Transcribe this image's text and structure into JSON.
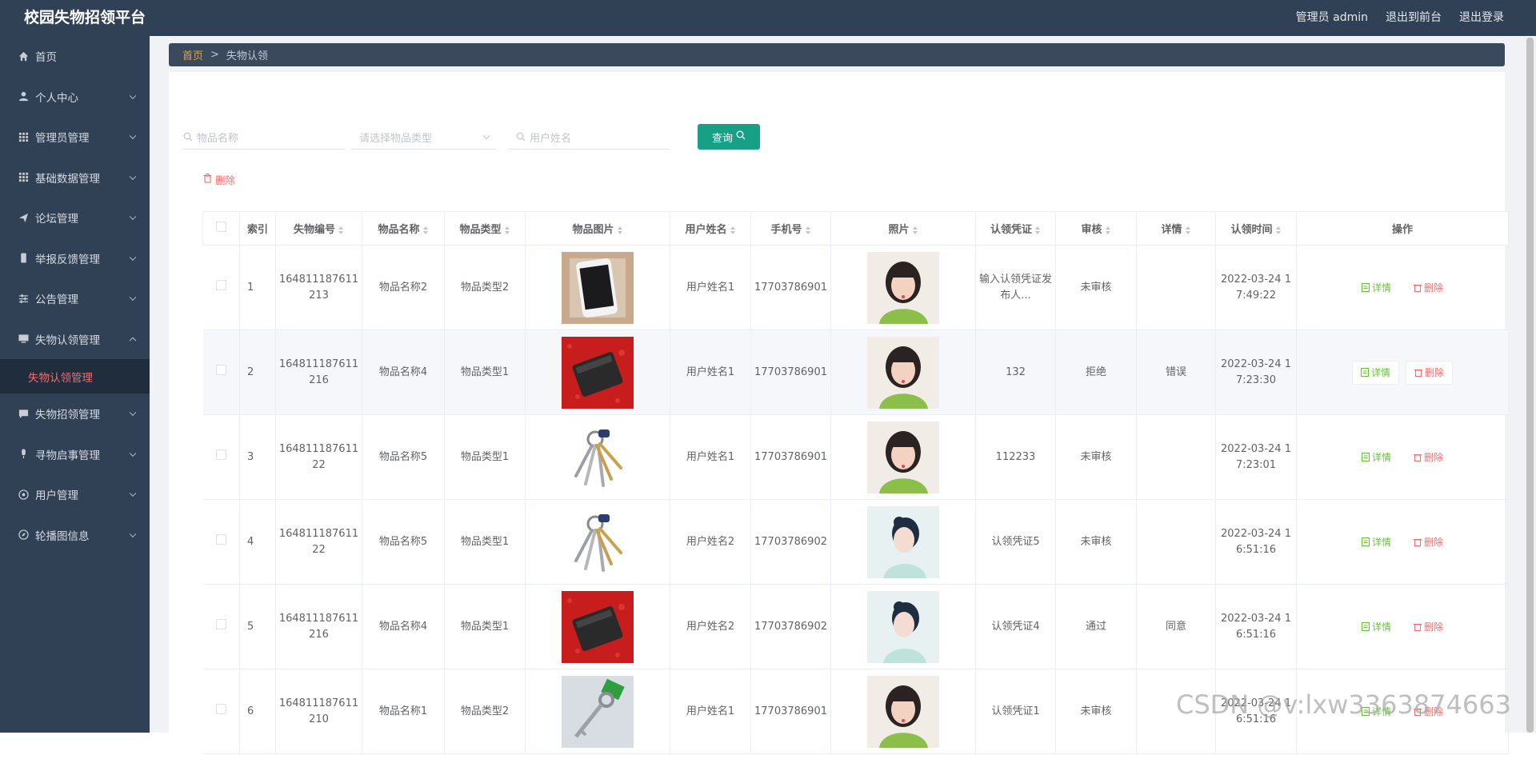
{
  "header": {
    "title": "校园失物招领平台",
    "admin_label": "管理员 admin",
    "exit_front": "退出到前台",
    "logout": "退出登录"
  },
  "sidebar": {
    "items": [
      {
        "label": "首页",
        "icon": "home-icon"
      },
      {
        "label": "个人中心",
        "icon": "user-icon"
      },
      {
        "label": "管理员管理",
        "icon": "grid-icon"
      },
      {
        "label": "基础数据管理",
        "icon": "grid-icon"
      },
      {
        "label": "论坛管理",
        "icon": "send-icon"
      },
      {
        "label": "举报反馈管理",
        "icon": "phone-icon"
      },
      {
        "label": "公告管理",
        "icon": "sliders-icon"
      },
      {
        "label": "失物认领管理",
        "icon": "monitor-icon"
      },
      {
        "label": "失物招领管理",
        "icon": "chat-icon"
      },
      {
        "label": "寻物启事管理",
        "icon": "mic-icon"
      },
      {
        "label": "用户管理",
        "icon": "globe-icon"
      },
      {
        "label": "轮播图信息",
        "icon": "compass-icon"
      }
    ],
    "active_sub": "失物认领管理"
  },
  "breadcrumb": {
    "home": "首页",
    "separator": ">",
    "current": "失物认领"
  },
  "filters": {
    "item_name_placeholder": "物品名称",
    "item_type_placeholder": "请选择物品类型",
    "user_name_placeholder": "用户姓名",
    "query_label": "查询"
  },
  "actions": {
    "delete_label": "删除"
  },
  "table": {
    "columns": [
      "索引",
      "失物编号",
      "物品名称",
      "物品类型",
      "物品图片",
      "用户姓名",
      "手机号",
      "照片",
      "认领凭证",
      "审核",
      "详情",
      "认领时间",
      "操作"
    ],
    "view_label": "详情",
    "del_label": "删除",
    "rows": [
      {
        "index": "1",
        "code": "164811187611213",
        "name": "物品名称2",
        "type": "物品类型2",
        "img": "phone",
        "user": "用户姓名1",
        "phone": "17703786901",
        "photo": "girl1",
        "proof": "输入认领凭证发布人...",
        "review": "未审核",
        "detail": "",
        "time": "2022-03-24 17:49:22"
      },
      {
        "index": "2",
        "code": "164811187611216",
        "name": "物品名称4",
        "type": "物品类型1",
        "img": "wallet",
        "user": "用户姓名1",
        "phone": "17703786901",
        "photo": "girl1",
        "proof": "132",
        "review": "拒绝",
        "detail": "错误",
        "time": "2022-03-24 17:23:30"
      },
      {
        "index": "3",
        "code": "16481118761122",
        "name": "物品名称5",
        "type": "物品类型1",
        "img": "keys",
        "user": "用户姓名1",
        "phone": "17703786901",
        "photo": "girl1",
        "proof": "112233",
        "review": "未审核",
        "detail": "",
        "time": "2022-03-24 17:23:01"
      },
      {
        "index": "4",
        "code": "16481118761122",
        "name": "物品名称5",
        "type": "物品类型1",
        "img": "keys",
        "user": "用户姓名2",
        "phone": "17703786902",
        "photo": "girl2",
        "proof": "认领凭证5",
        "review": "未审核",
        "detail": "",
        "time": "2022-03-24 16:51:16"
      },
      {
        "index": "5",
        "code": "164811187611216",
        "name": "物品名称4",
        "type": "物品类型1",
        "img": "wallet",
        "user": "用户姓名2",
        "phone": "17703786902",
        "photo": "girl2",
        "proof": "认领凭证4",
        "review": "通过",
        "detail": "同意",
        "time": "2022-03-24 16:51:16"
      },
      {
        "index": "6",
        "code": "164811187611210",
        "name": "物品名称1",
        "type": "物品类型2",
        "img": "key",
        "user": "用户姓名1",
        "phone": "17703786901",
        "photo": "girl1",
        "proof": "认领凭证1",
        "review": "未审核",
        "detail": "",
        "time": "2022-03-24 16:51:16"
      }
    ]
  },
  "watermark": "CSDN @v:lxw3363874663",
  "colors": {
    "sidebar": "#304156",
    "accent": "#16a085",
    "danger": "#f56c6c",
    "success": "#67c23a",
    "breadcrumb_home": "#e6a23c"
  }
}
